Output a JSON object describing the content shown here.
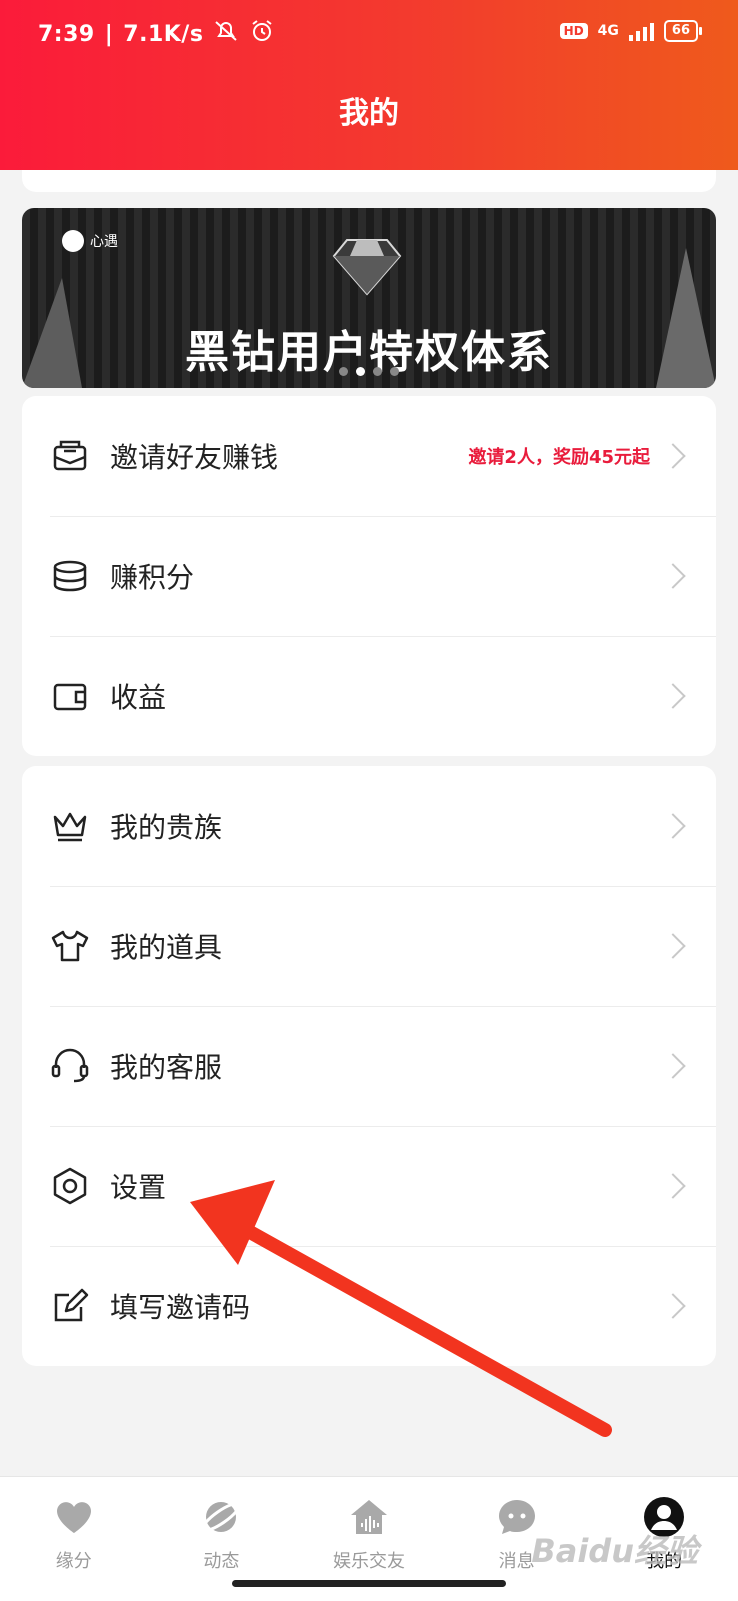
{
  "status_bar": {
    "time": "7:39",
    "speed": "7.1K/s",
    "hd": "HD",
    "network": "4G",
    "battery": "66"
  },
  "header": {
    "title": "我的"
  },
  "banner": {
    "brand": "心遇",
    "headline": "黑钻用户特权体系",
    "dots": 4,
    "active_dot": 2
  },
  "card1": {
    "items": [
      {
        "label": "邀请好友赚钱",
        "hint": "邀请2人，奖励45元起",
        "icon": "envelope-icon"
      },
      {
        "label": "赚积分",
        "icon": "coins-stack-icon"
      },
      {
        "label": "收益",
        "icon": "wallet-icon"
      }
    ]
  },
  "card2": {
    "items": [
      {
        "label": "我的贵族",
        "icon": "crown-icon"
      },
      {
        "label": "我的道具",
        "icon": "tshirt-icon"
      },
      {
        "label": "我的客服",
        "icon": "headset-icon"
      },
      {
        "label": "设置",
        "icon": "settings-hexagon-icon"
      },
      {
        "label": "填写邀请码",
        "icon": "edit-icon"
      }
    ]
  },
  "tabbar": {
    "tabs": [
      {
        "label": "缘分",
        "icon": "heart-icon"
      },
      {
        "label": "动态",
        "icon": "planet-icon"
      },
      {
        "label": "娱乐交友",
        "icon": "house-audio-icon"
      },
      {
        "label": "消息",
        "icon": "chat-bubble-icon"
      },
      {
        "label": "我的",
        "icon": "avatar-icon",
        "active": true
      }
    ]
  },
  "watermark": "Baidu经验",
  "colors": {
    "header_start": "#fb1b3a",
    "header_end": "#ef5a1c",
    "accent_red": "#e91c3c",
    "arrow": "#f2341f"
  }
}
